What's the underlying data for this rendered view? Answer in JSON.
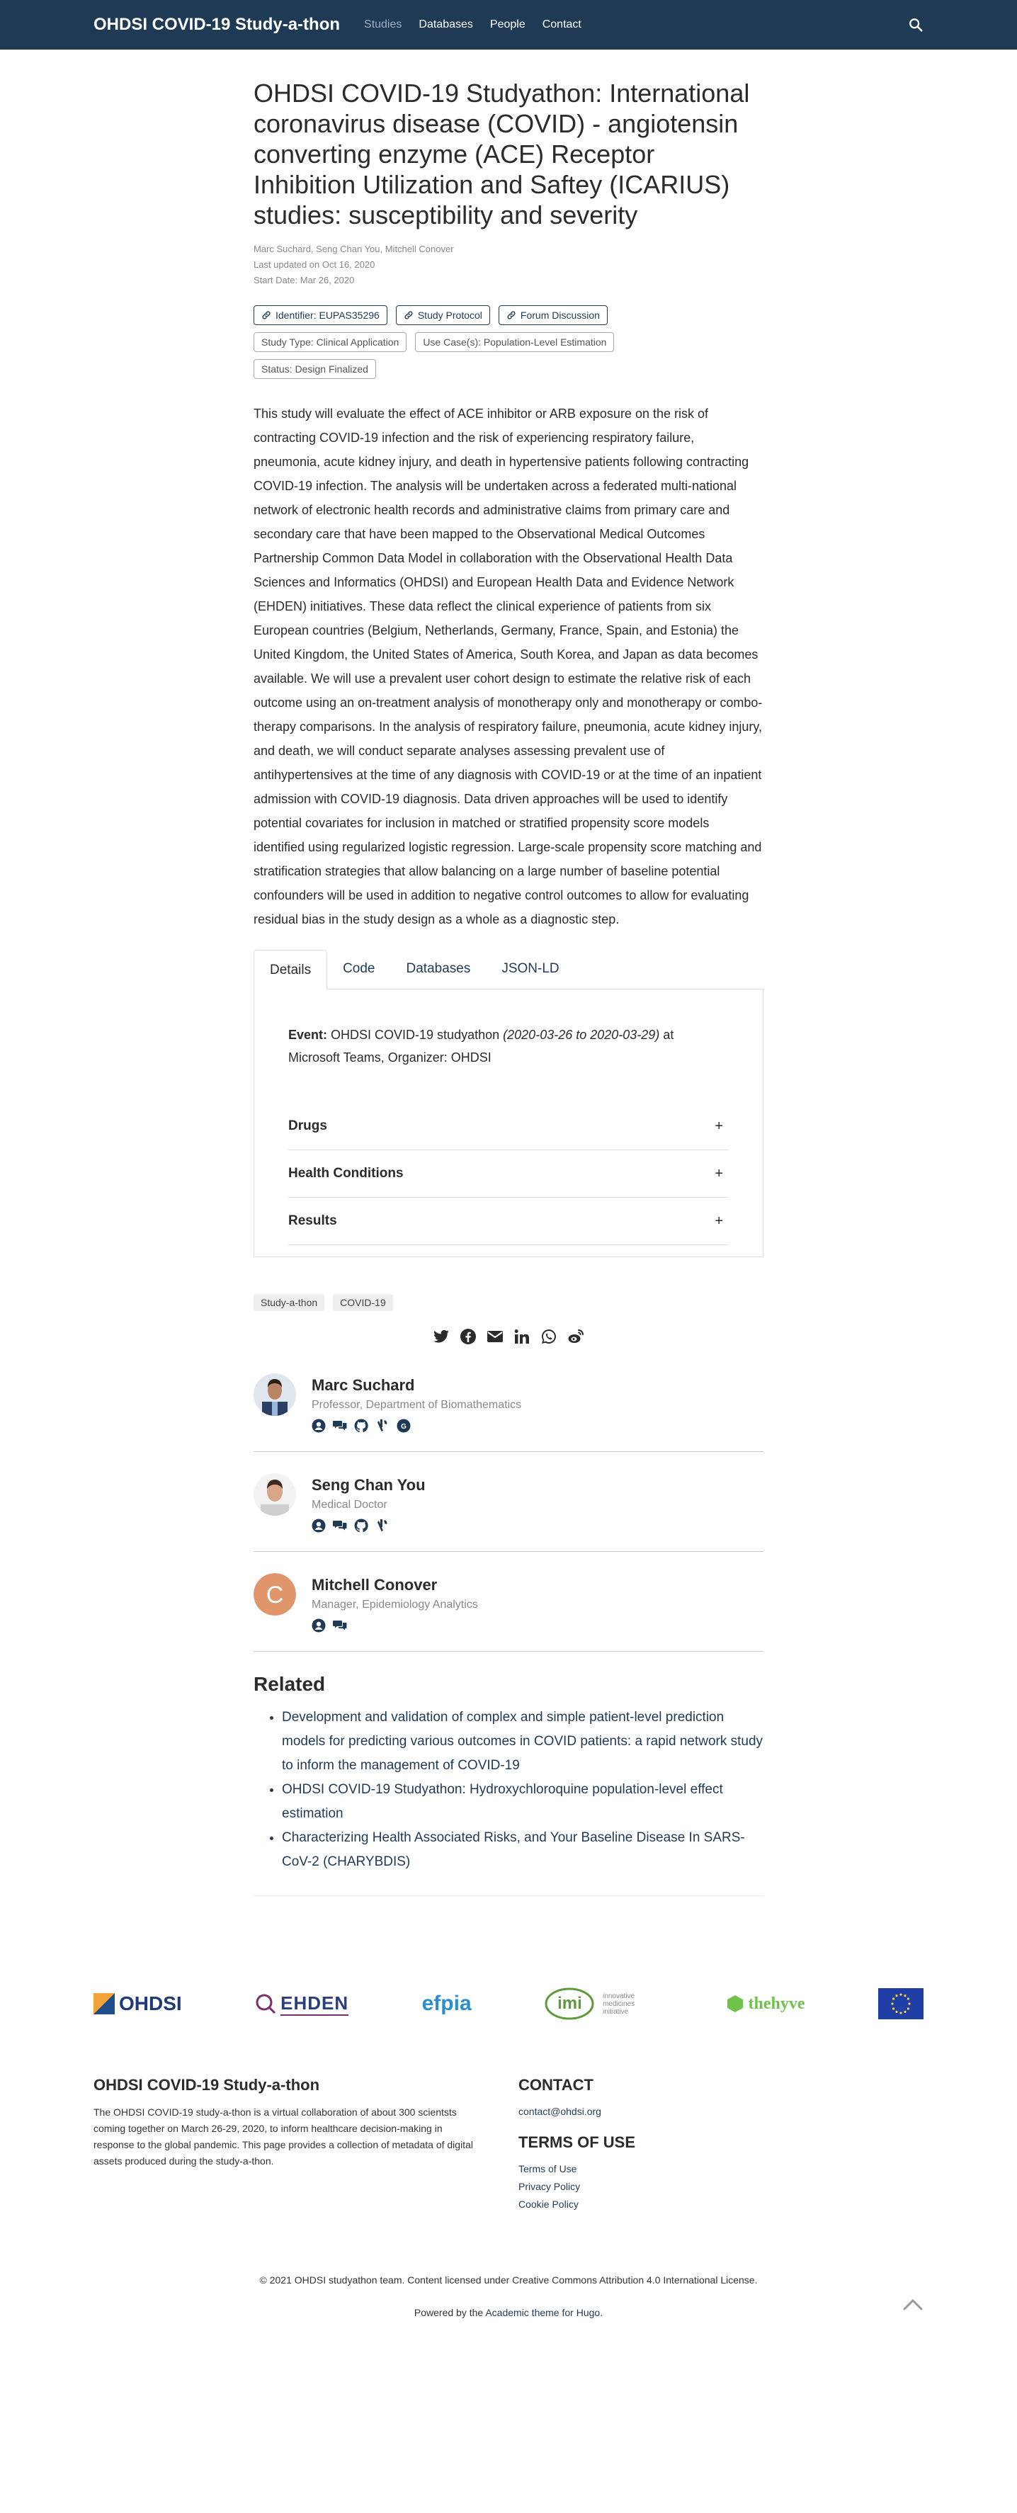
{
  "nav": {
    "brand": "OHDSI COVID-19 Study-a-thon",
    "links": [
      "Studies",
      "Databases",
      "People",
      "Contact"
    ]
  },
  "title": "OHDSI COVID-19 Studyathon: International coronavirus disease (COVID) - angiotensin converting enzyme (ACE) Receptor Inhibition Utilization and Saftey (ICARIUS) studies: susceptibility and severity",
  "meta": {
    "authors": "Marc Suchard, Seng Chan You, Mitchell Conover",
    "updated": "Last updated on Oct 16, 2020",
    "start": "Start Date: Mar 26, 2020"
  },
  "chips": {
    "identifier": "Identifier: EUPAS35296",
    "protocol": "Study Protocol",
    "forum": "Forum Discussion",
    "study_type": "Study Type: Clinical Application",
    "use_case": "Use Case(s): Population-Level Estimation",
    "status": "Status: Design Finalized"
  },
  "abstract": "This study will evaluate the effect of ACE inhibitor or ARB exposure on the risk of contracting COVID-19 infection and the risk of experiencing respiratory failure, pneumonia, acute kidney injury, and death in hypertensive patients following contracting COVID-19 infection. The analysis will be undertaken across a federated multi-national network of electronic health records and administrative claims from primary care and secondary care that have been mapped to the Observational Medical Outcomes Partnership Common Data Model in collaboration with the Observational Health Data Sciences and Informatics (OHDSI) and European Health Data and Evidence Network (EHDEN) initiatives. These data reflect the clinical experience of patients from six European countries (Belgium, Netherlands, Germany, France, Spain, and Estonia) the United Kingdom, the United States of America, South Korea, and Japan as data becomes available. We will use a prevalent user cohort design to estimate the relative risk of each outcome using an on-treatment analysis of monotherapy only and monotherapy or combo-therapy comparisons. In the analysis of respiratory failure, pneumonia, acute kidney injury, and death, we will conduct separate analyses assessing prevalent use of antihypertensives at the time of any diagnosis with COVID-19 or at the time of an inpatient admission with COVID-19 diagnosis. Data driven approaches will be used to identify potential covariates for inclusion in matched or stratified propensity score models identified using regularized logistic regression. Large-scale propensity score matching and stratification strategies that allow balancing on a large number of baseline potential confounders will be used in addition to negative control outcomes to allow for evaluating residual bias in the study design as a whole as a diagnostic step.",
  "tabs": [
    "Details",
    "Code",
    "Databases",
    "JSON-LD"
  ],
  "event": {
    "label": "Event:",
    "name": "OHDSI COVID-19 studyathon",
    "dates": "(2020-03-26 to 2020-03-29)",
    "location": "at Microsoft Teams, Organizer: OHDSI"
  },
  "accordion": [
    "Drugs",
    "Health Conditions",
    "Results"
  ],
  "tags": [
    "Study-a-thon",
    "COVID-19"
  ],
  "share_icons": [
    "twitter-icon",
    "facebook-icon",
    "email-icon",
    "linkedin-icon",
    "whatsapp-icon",
    "weibo-icon"
  ],
  "authors": [
    {
      "name": "Marc Suchard",
      "role": "Professor, Department of Biomathematics"
    },
    {
      "name": "Seng Chan You",
      "role": "Medical Doctor"
    },
    {
      "name": "Mitchell Conover",
      "role": "Manager, Epidemiology Analytics",
      "initial": "C"
    }
  ],
  "related": {
    "title": "Related",
    "items": [
      "Development and validation of complex and simple patient-level prediction models for predicting various outcomes in COVID patients: a rapid network study to inform the management of COVID-19",
      "OHDSI COVID-19 Studyathon: Hydroxychloroquine population-level effect estimation",
      "Characterizing Health Associated Risks, and Your Baseline Disease In SARS-CoV-2 (CHARYBDIS)"
    ]
  },
  "logos": {
    "ohdsi": "OHDSI",
    "ehden": "EHDEN",
    "efpia": "efpia",
    "imi": "imi",
    "imi_sub": "innovative medicines initiative",
    "thehyve": "thehyve"
  },
  "footer": {
    "title": "OHDSI COVID-19 Study-a-thon",
    "text": "The OHDSI COVID-19 study-a-thon is a virtual collaboration of about 300 scientsts coming together on March 26-29, 2020, to inform healthcare decision-making in response to the global pandemic. This page provides a collection of metadata of digital assets produced during the study-a-thon.",
    "contact_title": "CONTACT",
    "contact_email": "contact@ohdsi.org",
    "terms_title": "TERMS OF USE",
    "terms_links": [
      "Terms of Use",
      "Privacy Policy",
      "Cookie Policy"
    ],
    "copyright": "© 2021 OHDSI studyathon team. Content licensed under Creative Commons Attribution 4.0 International License.",
    "powered_prefix": "Powered by the",
    "powered_link": "Academic theme for Hugo",
    "powered_suffix": "."
  },
  "colors": {
    "navbar": "#1f3a55",
    "link": "#1f3a55",
    "avatar_c": "#e0956a"
  }
}
